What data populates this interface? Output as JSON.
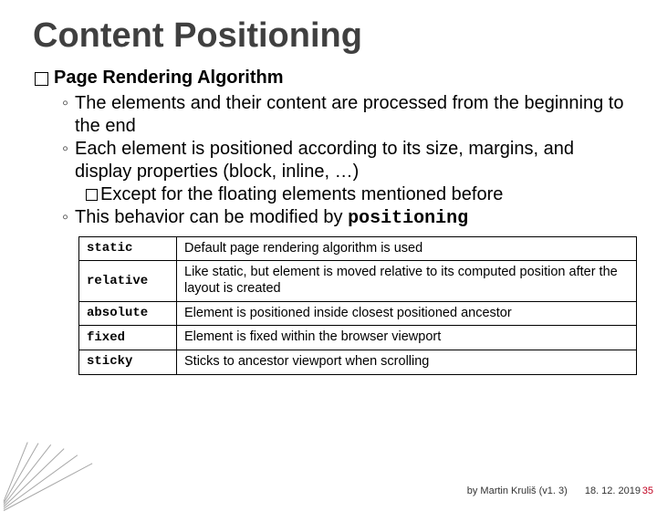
{
  "title": "Content Positioning",
  "heading": "Page Rendering Algorithm",
  "bullets": [
    "The elements and their content are processed from the beginning to the end",
    "Each element is positioned according to its size, margins, and display properties (block, inline, …)"
  ],
  "sub_bullet": "Except for the floating elements mentioned before",
  "bullet_modify_pre": "This behavior can be modified by ",
  "bullet_modify_code": "positioning",
  "table": {
    "rows": [
      {
        "key": "static",
        "desc": "Default page rendering algorithm is used"
      },
      {
        "key": "relative",
        "desc": "Like static, but element is moved relative to its computed position after the layout is created"
      },
      {
        "key": "absolute",
        "desc": "Element is positioned inside closest positioned ancestor"
      },
      {
        "key": "fixed",
        "desc": "Element is fixed within the browser viewport"
      },
      {
        "key": "sticky",
        "desc": "Sticks to ancestor viewport when scrolling"
      }
    ]
  },
  "footer": {
    "author": "by Martin Kruliš (v1. 3)",
    "date": "18. 12. 2019",
    "page": "35"
  }
}
